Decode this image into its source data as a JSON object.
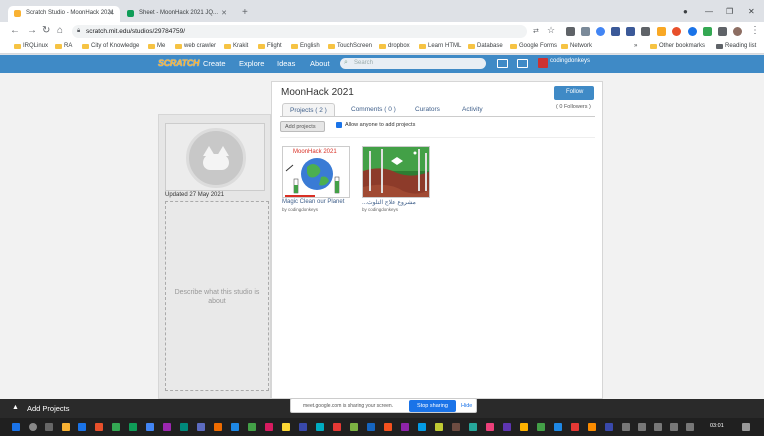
{
  "browser": {
    "tabs": [
      {
        "title": "Scratch Studio - MoonHack 2021",
        "favicon_color": "#f9b233",
        "active": true
      },
      {
        "title": "Sheet - MoonHack 2021 JQ...",
        "favicon_color": "#0f9d58",
        "active": false
      }
    ],
    "url": "scratch.mit.edu/studios/29784759/",
    "bookmarks": [
      "IRQLinux",
      "RA",
      "City of Knowledge",
      "Me",
      "web crawler",
      "Krakit",
      "Flight",
      "English",
      "TouchScreen",
      "dropbox",
      "Learn HTML",
      "Database",
      "Google Forms",
      "Network"
    ],
    "other_bookmarks": "Other bookmarks",
    "reading_list": "Reading list"
  },
  "scratch_nav": {
    "logo": "SCRATCH",
    "links": [
      "Create",
      "Explore",
      "Ideas",
      "About"
    ],
    "search_placeholder": "Search",
    "username": "codingdonkeys"
  },
  "studio": {
    "title": "MoonHack 2021",
    "follow_label": "Follow",
    "followers": "( 0 Followers )",
    "tabs": [
      "Projects ( 2 )",
      "Comments ( 0 )",
      "Curators",
      "Activity"
    ],
    "add_projects_label": "Add projects",
    "allow_label": "Allow anyone to add projects",
    "updated": "Updated 27 May 2021",
    "description_placeholder": "Describe what this studio is about",
    "projects": [
      {
        "title": "Magic Clean our Planet",
        "by": "by codingdonkeys",
        "banner": "MoonHack 2021"
      },
      {
        "title": "...مشروع علاج التلوث",
        "by": "by codingdonkeys"
      }
    ]
  },
  "bottom": {
    "add_projects": "Add Projects",
    "share_text": "meet.google.com is sharing your screen.",
    "stop_sharing": "Stop sharing",
    "hide": "Hide"
  },
  "taskbar": {
    "time": "03:01"
  }
}
